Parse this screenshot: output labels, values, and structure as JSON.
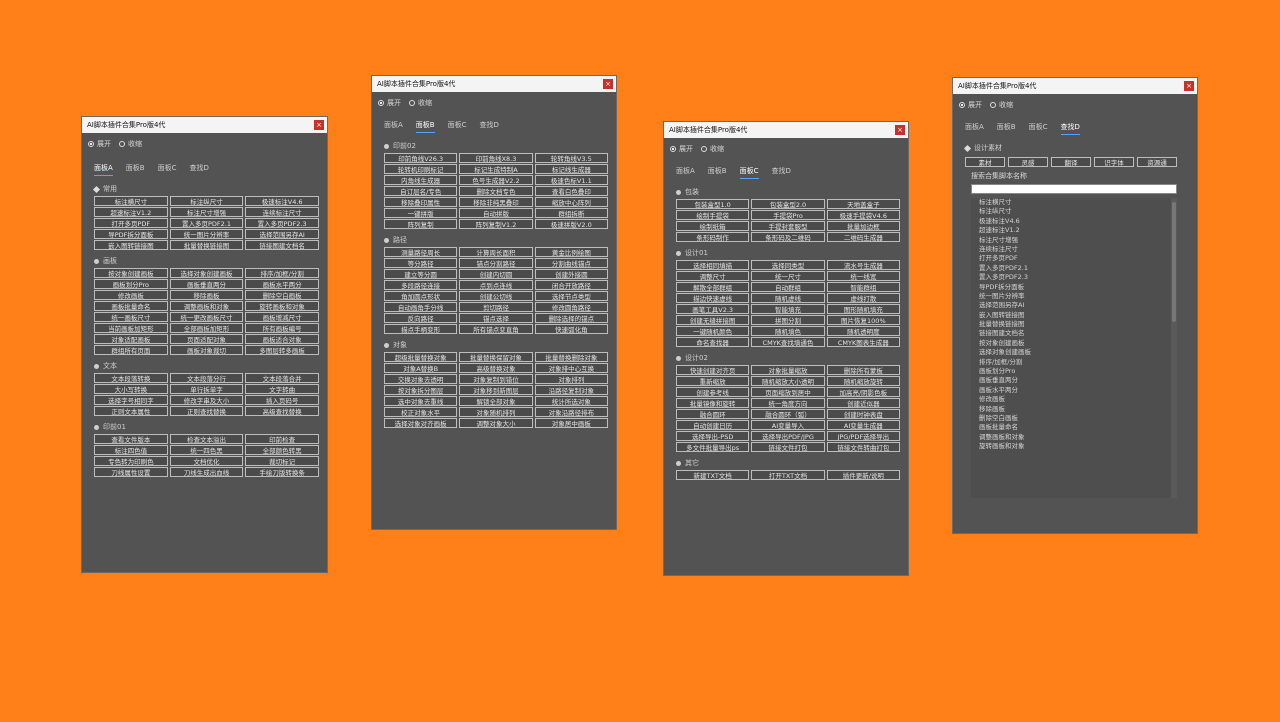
{
  "p1": {
    "title": "AI脚本插件合集Pro版4代",
    "close": "×",
    "expand": "展开",
    "collapse": "收缩",
    "tabs": [
      "面板A",
      "面板B",
      "面板C",
      "查找D"
    ],
    "sections": [
      {
        "label": "常用",
        "marker": "diamond",
        "buttons": [
          "标注横尺寸",
          "标注纵尺寸",
          "极速标注V4.6",
          "超速标注V1.2",
          "标注尺寸增强",
          "连续标注尺寸",
          "打开多页PDF",
          "置入多页PDF2.1",
          "置入多页PDF2.3",
          "导PDF拆分面板",
          "统一图片分辨率",
          "选择范围另存AI",
          "嵌入图转链接图",
          "批量替换链接图",
          "链接图建文档名"
        ]
      },
      {
        "label": "画板",
        "marker": "dot",
        "buttons": [
          "按对象创建画板",
          "选择对象创建画板",
          "排序/加框/分割",
          "画板划分Pro",
          "画板垂直两分",
          "画板水平两分",
          "修改画板",
          "移除画板",
          "删除空白画板",
          "画板批量命名",
          "调整画板和对象",
          "旋转画板和对象",
          "统一画板尺寸",
          "统一更改画板尺寸",
          "画板增减尺寸",
          "当前画板加矩形",
          "全部画板加矩形",
          "所有画板编号",
          "对象适配画板",
          "页面适配对象",
          "画板适合对象",
          "群组所有页面",
          "画板对象裁切",
          "多图层转多画板"
        ]
      },
      {
        "label": "文本",
        "marker": "dot",
        "buttons": [
          "文本段落转换",
          "文本段落分行",
          "文本段落合并",
          "大小写转换",
          "单行拆单字",
          "文字转曲",
          "选择字号相同字",
          "修改字串及大小",
          "插入页码号",
          "正则文本属性",
          "正则查找替换",
          "高级查找替换"
        ]
      },
      {
        "label": "印前01",
        "marker": "dot",
        "buttons": [
          "查看文件版本",
          "检查文本溢出",
          "印前检查",
          "标注四色值",
          "统一四色黑",
          "全部颜色转黑",
          "专色转为印刷色",
          "文档优化",
          "裁切标记",
          "刀线属性设置",
          "刀线生成出血线",
          "手绘刀版转换条"
        ]
      }
    ]
  },
  "p2": {
    "title": "AI脚本插件合集Pro版4代",
    "close": "×",
    "expand": "展开",
    "collapse": "收缩",
    "tabs": [
      "面板A",
      "面板B",
      "面板C",
      "查找D"
    ],
    "sections": [
      {
        "label": "印前02",
        "marker": "dot",
        "buttons": [
          "印前角线V26.3",
          "印前角线X8.3",
          "轮转角线V3.5",
          "轮转机印刷标记",
          "标记生成特制A",
          "标记线生成器",
          "内角线生成器",
          "色号生成器V2.2",
          "极速色标V1.1",
          "自订层名/专色",
          "删除文档专色",
          "查看白色叠印",
          "移除叠印属性",
          "移除非纯黑叠印",
          "缩放中心阵列",
          "一键拼版",
          "自动拼版",
          "群组拆断",
          "阵列复制",
          "阵列复制V1.2",
          "极速拼版V2.0"
        ]
      },
      {
        "label": "路径",
        "marker": "dot",
        "buttons": [
          "测量路径周长",
          "计算周长面积",
          "黄金比例绘图",
          "等分路径",
          "锚点分割路径",
          "分割曲线锚点",
          "建立等分圆",
          "创建内切圆",
          "创建外接圆",
          "多段路径连接",
          "点到点连线",
          "闭合开放路径",
          "角加圆点形状",
          "创建公切线",
          "选择节点类型",
          "自动画角手分线",
          "剪切路径",
          "修改圆角路径",
          "反向路径",
          "锚点选择",
          "删除选择的锚点",
          "描点手柄变形",
          "所有锚点变直角",
          "快速弧化角"
        ]
      },
      {
        "label": "对象",
        "marker": "dot",
        "buttons": [
          "超级批量替换对象",
          "批量替换保留对象",
          "批量替换删除对象",
          "对象A替换B",
          "高级替换对象",
          "对象排中心互换",
          "交换对象去透明",
          "对象复制到错位",
          "对象排列",
          "按对象拆分图层",
          "对象移到新图层",
          "沿路径复制对象",
          "选中对象去重线",
          "解锁全部对象",
          "统计所选对象",
          "校正对象水平",
          "对象随机排列",
          "对象沿路径排布",
          "选择对象对齐画板",
          "调整对象大小",
          "对象居中画板"
        ]
      }
    ]
  },
  "p3": {
    "title": "AI脚本插件合集Pro版4代",
    "close": "×",
    "expand": "展开",
    "collapse": "收缩",
    "tabs": [
      "面板A",
      "面板B",
      "面板C",
      "查找D"
    ],
    "sections": [
      {
        "label": "包装",
        "marker": "dot",
        "buttons": [
          "包装盒型1.0",
          "包装盒型2.0",
          "天地盖盒子",
          "绘制手提袋",
          "手提袋Pro",
          "极速手提袋V4.6",
          "绘制纸箱",
          "手提封套服型",
          "批量加边框",
          "条形码制作",
          "条形码及二维码",
          "二维码生成器"
        ]
      },
      {
        "label": "设计01",
        "marker": "dot",
        "buttons": [
          "选择相同填描",
          "选择同类型",
          "流水号生成器",
          "调整尺寸",
          "统一尺寸",
          "统一线宽",
          "解散全部群组",
          "自动群组",
          "智能群组",
          "描边快速虚线",
          "随机虚线",
          "虚线打散",
          "画笔工具V2.3",
          "智能填充",
          "图形随机填充",
          "创建无缝拼接图",
          "拼图分割",
          "图片恢复100%",
          "一键随机颜色",
          "随机填色",
          "随机透明度",
          "命名查找器",
          "CMYK查找填通色",
          "CMYK图表生成器"
        ]
      },
      {
        "label": "设计02",
        "marker": "dot",
        "buttons": [
          "快速创建对齐页",
          "对象批量缩放",
          "删除所有蒙板",
          "重新缩放",
          "随机缩放大小透明",
          "随机缩放旋转",
          "创建参考线",
          "页面缩放到居中",
          "加高亮/阴影色板",
          "批量镜像和旋转",
          "统一角度方向",
          "创建近似器",
          "融合圆环",
          "融合圆环（弧）",
          "创建时钟表盘",
          "自动创建日历",
          "AI变量导入",
          "AI变量生成器",
          "选择导出-PSD",
          "选择导出PDF/JPG",
          "JPG/PDF选择导出",
          "多文件批量导出ps",
          "链接文件打包",
          "链接文件转曲打包"
        ]
      },
      {
        "label": "其它",
        "marker": "dot",
        "buttons": [
          "新建TXT文档",
          "打开TXT文档",
          "插件更新/说明"
        ]
      }
    ]
  },
  "p4": {
    "title": "AI脚本插件合集Pro版4代",
    "close": "×",
    "expand": "展开",
    "collapse": "收缩",
    "tabs": [
      "面板A",
      "面板B",
      "面板C",
      "查找D"
    ],
    "section_label": "设计素材",
    "buttons": [
      "素材",
      "灵感",
      "翻译",
      "识字体",
      "资源通"
    ],
    "search_label": "搜索合集脚本名称",
    "search_value": "",
    "list": [
      "标注横尺寸",
      "标注纵尺寸",
      "极速标注V4.6",
      "超速标注V1.2",
      "标注尺寸增强",
      "连续标注尺寸",
      "打开多页PDF",
      "置入多页PDF2.1",
      "置入多页PDF2.3",
      "导PDF拆分面板",
      "统一图片分辨率",
      "选择范围另存AI",
      "嵌入图转链接图",
      "批量替换链接图",
      "链接图建文档名",
      "按对象创建画板",
      "选择对象创建画板",
      "排序/加框/分割",
      "画板划分Pro",
      "画板垂直两分",
      "画板水平两分",
      "修改画板",
      "移除画板",
      "删除空白画板",
      "画板批量命名",
      "调整画板和对象",
      "旋转画板和对象"
    ]
  }
}
